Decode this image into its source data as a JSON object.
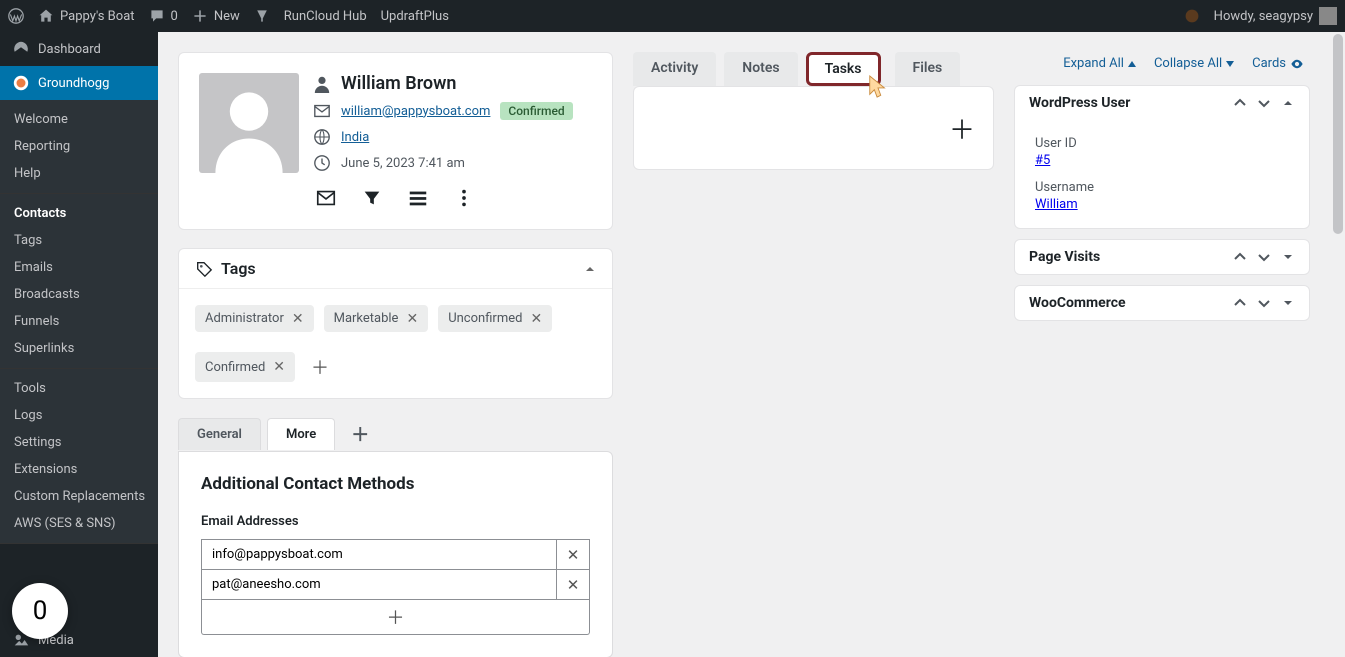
{
  "adminbar": {
    "site_name": "Pappy's Boat",
    "comments": "0",
    "new": "New",
    "runcloud": "RunCloud Hub",
    "updraft": "UpdraftPlus",
    "howdy": "Howdy, seagypsy"
  },
  "sidebar": {
    "dashboard": "Dashboard",
    "groundhogg": "Groundhogg",
    "sub": {
      "welcome": "Welcome",
      "reporting": "Reporting",
      "help": "Help",
      "contacts": "Contacts",
      "tags": "Tags",
      "emails": "Emails",
      "broadcasts": "Broadcasts",
      "funnels": "Funnels",
      "superlinks": "Superlinks",
      "tools": "Tools",
      "logs": "Logs",
      "settings": "Settings",
      "extensions": "Extensions",
      "custom": "Custom Replacements",
      "aws": "AWS (SES & SNS)"
    },
    "media": "Media",
    "fab": "0"
  },
  "contact": {
    "name": "William Brown",
    "email": "william@pappysboat.com",
    "status": "Confirmed",
    "country": "India",
    "created": "June 5, 2023 7:41 am"
  },
  "tags_section": {
    "title": "Tags",
    "tags": [
      "Administrator",
      "Marketable",
      "Unconfirmed",
      "Confirmed"
    ]
  },
  "detail_tabs": {
    "general": "General",
    "more": "More"
  },
  "additional": {
    "heading": "Additional Contact Methods",
    "email_label": "Email Addresses",
    "emails": [
      "info@pappysboat.com",
      "pat@aneesho.com"
    ]
  },
  "mid_tabs": {
    "activity": "Activity",
    "notes": "Notes",
    "tasks": "Tasks",
    "files": "Files"
  },
  "meta": {
    "expand": "Expand All",
    "collapse": "Collapse All",
    "cards": "Cards"
  },
  "panels": {
    "wp": {
      "title": "WordPress User",
      "userid_label": "User ID",
      "userid": "#5",
      "username_label": "Username",
      "username": "William"
    },
    "page_visits": "Page Visits",
    "woo": "WooCommerce"
  }
}
